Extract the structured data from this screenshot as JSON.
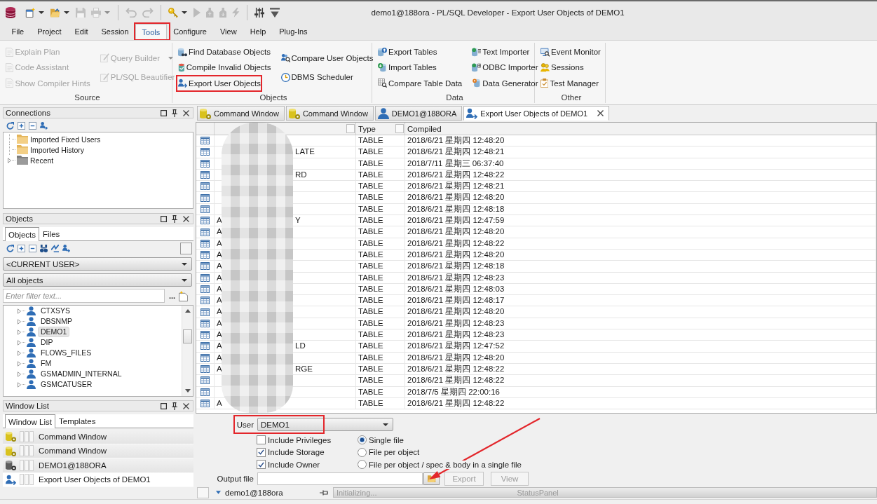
{
  "window": {
    "title": "demo1@188ora - PL/SQL Developer - Export User Objects of DEMO1"
  },
  "quick_access": [
    [
      {
        "disabled": false,
        "kind": "split"
      },
      {
        "disabled": false,
        "kind": "split"
      },
      {
        "disabled": true,
        "kind": "plain"
      },
      {
        "disabled": true,
        "kind": "split"
      }
    ],
    [
      {
        "disabled": true,
        "kind": "plain"
      },
      {
        "disabled": true,
        "kind": "plain"
      }
    ],
    [
      {
        "disabled": false,
        "kind": "split"
      },
      {
        "disabled": true,
        "kind": "plain"
      },
      {
        "disabled": true,
        "kind": "plain"
      },
      {
        "disabled": true,
        "kind": "plain"
      },
      {
        "disabled": true,
        "kind": "plain"
      }
    ],
    [
      {
        "disabled": false,
        "kind": "plain"
      },
      {
        "disabled": false,
        "kind": "plain"
      }
    ]
  ],
  "menu": [
    {
      "label": "File",
      "selected": false,
      "highlighted": false
    },
    {
      "label": "Project",
      "selected": false,
      "highlighted": false
    },
    {
      "label": "Edit",
      "selected": false,
      "highlighted": false
    },
    {
      "label": "Session",
      "selected": false,
      "highlighted": false
    },
    {
      "label": "Tools",
      "selected": true,
      "highlighted": true
    },
    {
      "label": "Configure",
      "selected": false,
      "highlighted": false
    },
    {
      "label": "View",
      "selected": false,
      "highlighted": false
    },
    {
      "label": "Help",
      "selected": false,
      "highlighted": false
    },
    {
      "label": "Plug-Ins",
      "selected": false,
      "highlighted": false
    }
  ],
  "ribbon": {
    "groups": [
      {
        "label": "Source",
        "columns": [
          [
            {
              "label": "Explain Plan",
              "disabled": true,
              "dropdown": false,
              "highlighted": false
            },
            {
              "label": "Code Assistant",
              "disabled": true,
              "dropdown": false,
              "highlighted": false
            },
            {
              "label": "Show Compiler Hints",
              "disabled": true,
              "dropdown": false,
              "highlighted": false
            }
          ],
          [
            {
              "label": "Query Builder",
              "disabled": true,
              "dropdown": true,
              "highlighted": false
            },
            {
              "label": "PL/SQL Beautifier",
              "disabled": true,
              "dropdown": false,
              "highlighted": false
            }
          ]
        ]
      },
      {
        "label": "Objects",
        "columns": [
          [
            {
              "label": "Find Database Objects",
              "disabled": false,
              "dropdown": false,
              "highlighted": false
            },
            {
              "label": "Compile Invalid Objects",
              "disabled": false,
              "dropdown": false,
              "highlighted": false
            },
            {
              "label": "Export User Objects",
              "disabled": false,
              "dropdown": false,
              "highlighted": true
            }
          ],
          [
            {
              "label": "Compare User Objects",
              "disabled": false,
              "dropdown": false,
              "highlighted": false
            },
            {
              "label": "DBMS Scheduler",
              "disabled": false,
              "dropdown": false,
              "highlighted": false
            }
          ]
        ]
      },
      {
        "label": "Data",
        "columns": [
          [
            {
              "label": "Export Tables",
              "disabled": false,
              "dropdown": false,
              "highlighted": false
            },
            {
              "label": "Import Tables",
              "disabled": false,
              "dropdown": false,
              "highlighted": false
            },
            {
              "label": "Compare Table Data",
              "disabled": false,
              "dropdown": false,
              "highlighted": false
            }
          ],
          [
            {
              "label": "Text Importer",
              "disabled": false,
              "dropdown": false,
              "highlighted": false
            },
            {
              "label": "ODBC Importer",
              "disabled": false,
              "dropdown": false,
              "highlighted": false
            },
            {
              "label": "Data Generator",
              "disabled": false,
              "dropdown": false,
              "highlighted": false
            }
          ]
        ]
      },
      {
        "label": "Other",
        "columns": [
          [
            {
              "label": "Event Monitor",
              "disabled": false,
              "dropdown": false,
              "highlighted": false
            },
            {
              "label": "Sessions",
              "disabled": false,
              "dropdown": false,
              "highlighted": false
            },
            {
              "label": "Test Manager",
              "disabled": false,
              "dropdown": false,
              "highlighted": false
            }
          ]
        ]
      }
    ]
  },
  "connections": {
    "title": "Connections",
    "items": [
      {
        "label": "Imported Fixed Users",
        "kind": "folder",
        "expandable": false
      },
      {
        "label": "Imported History",
        "kind": "folder",
        "expandable": false
      },
      {
        "label": "Recent",
        "kind": "recent",
        "expandable": true
      }
    ]
  },
  "objects": {
    "title": "Objects",
    "tabs": [
      {
        "label": "Objects",
        "selected": true
      },
      {
        "label": "Files",
        "selected": false
      }
    ],
    "owner_filter": "<CURRENT USER>",
    "type_filter": "All objects",
    "filter_placeholder": "Enter filter text...",
    "more_button": "...",
    "users": [
      {
        "label": "CTXSYS",
        "selected": false
      },
      {
        "label": "DBSNMP",
        "selected": false
      },
      {
        "label": "DEMO1",
        "selected": true
      },
      {
        "label": "DIP",
        "selected": false
      },
      {
        "label": "FLOWS_FILES",
        "selected": false
      },
      {
        "label": "FM",
        "selected": false
      },
      {
        "label": "GSMADMIN_INTERNAL",
        "selected": false
      },
      {
        "label": "GSMCATUSER",
        "selected": false
      }
    ]
  },
  "window_list": {
    "title": "Window List",
    "tabs": [
      {
        "label": "Window List",
        "selected": true
      },
      {
        "label": "Templates",
        "selected": false
      }
    ],
    "items": [
      {
        "label": "Command Window",
        "kind": "command",
        "selected": false
      },
      {
        "label": "Command Window",
        "kind": "command",
        "selected": false
      },
      {
        "label": "DEMO1@188ORA",
        "kind": "connection",
        "selected": false
      },
      {
        "label": "Export User Objects of DEMO1",
        "kind": "export",
        "selected": true
      }
    ]
  },
  "editor_tabs": [
    {
      "label": "Command Window",
      "kind": "command",
      "selected": false
    },
    {
      "label": "Command Window",
      "kind": "command",
      "selected": false
    },
    {
      "label": "DEMO1@188ORA",
      "kind": "connection",
      "selected": false
    },
    {
      "label": "Export User Objects of DEMO1",
      "kind": "export",
      "selected": true
    }
  ],
  "table": {
    "columns": [
      "Type",
      "Compiled"
    ],
    "names_redacted": true,
    "rows": [
      {
        "type": "TABLE",
        "compiled": "2018/6/21 星期四 12:48:20"
      },
      {
        "name_end": "LATE",
        "type": "TABLE",
        "compiled": "2018/6/21 星期四 12:48:21"
      },
      {
        "type": "TABLE",
        "compiled": "2018/7/11 星期三 06:37:40"
      },
      {
        "name_end": "RD",
        "type": "TABLE",
        "compiled": "2018/6/21 星期四 12:48:22"
      },
      {
        "type": "TABLE",
        "compiled": "2018/6/21 星期四 12:48:21"
      },
      {
        "type": "TABLE",
        "compiled": "2018/6/21 星期四 12:48:20"
      },
      {
        "type": "TABLE",
        "compiled": "2018/6/21 星期四 12:48:18"
      },
      {
        "name_start": "A",
        "name_end": "Y",
        "type": "TABLE",
        "compiled": "2018/6/21 星期四 12:47:59"
      },
      {
        "name_start": "A",
        "type": "TABLE",
        "compiled": "2018/6/21 星期四 12:48:20"
      },
      {
        "name_start": "A",
        "type": "TABLE",
        "compiled": "2018/6/21 星期四 12:48:22"
      },
      {
        "name_start": "A",
        "type": "TABLE",
        "compiled": "2018/6/21 星期四 12:48:20"
      },
      {
        "name_start": "A",
        "type": "TABLE",
        "compiled": "2018/6/21 星期四 12:48:18"
      },
      {
        "name_start": "A",
        "type": "TABLE",
        "compiled": "2018/6/21 星期四 12:48:23"
      },
      {
        "name_start": "A",
        "type": "TABLE",
        "compiled": "2018/6/21 星期四 12:48:03"
      },
      {
        "name_start": "A",
        "type": "TABLE",
        "compiled": "2018/6/21 星期四 12:48:17"
      },
      {
        "name_start": "A",
        "type": "TABLE",
        "compiled": "2018/6/21 星期四 12:48:20"
      },
      {
        "name_start": "A",
        "type": "TABLE",
        "compiled": "2018/6/21 星期四 12:48:23"
      },
      {
        "name_start": "A",
        "type": "TABLE",
        "compiled": "2018/6/21 星期四 12:48:23"
      },
      {
        "name_start": "A",
        "name_end": "LD",
        "type": "TABLE",
        "compiled": "2018/6/21 星期四 12:47:52"
      },
      {
        "name_start": "A",
        "type": "TABLE",
        "compiled": "2018/6/21 星期四 12:48:20"
      },
      {
        "name_start": "A",
        "name_end": "RGE",
        "type": "TABLE",
        "compiled": "2018/6/21 星期四 12:48:22"
      },
      {
        "type": "TABLE",
        "compiled": "2018/6/21 星期四 12:48:22"
      },
      {
        "type": "TABLE",
        "compiled": "2018/7/5 星期四 22:00:16"
      },
      {
        "name_start": "A",
        "type": "TABLE",
        "compiled": "2018/6/21 星期四 12:48:22"
      }
    ]
  },
  "export": {
    "user_label": "User",
    "user": "DEMO1",
    "user_highlighted": true,
    "options": [
      {
        "label": "Include Privileges",
        "checked": false
      },
      {
        "label": "Include Storage",
        "checked": true
      },
      {
        "label": "Include Owner",
        "checked": true
      }
    ],
    "file_modes": [
      {
        "label": "Single file",
        "selected": true
      },
      {
        "label": "File per object",
        "selected": false
      },
      {
        "label": "File per object / spec & body in a single file",
        "selected": false
      }
    ],
    "output_label": "Output file",
    "browse_arrow": true,
    "buttons": [
      {
        "label": "Export",
        "disabled": true
      },
      {
        "label": "View",
        "disabled": true
      }
    ]
  },
  "status_bar": {
    "connection": "demo1@188ora",
    "progress_text": "Initializing...",
    "panel_text": "StatusPanel"
  }
}
